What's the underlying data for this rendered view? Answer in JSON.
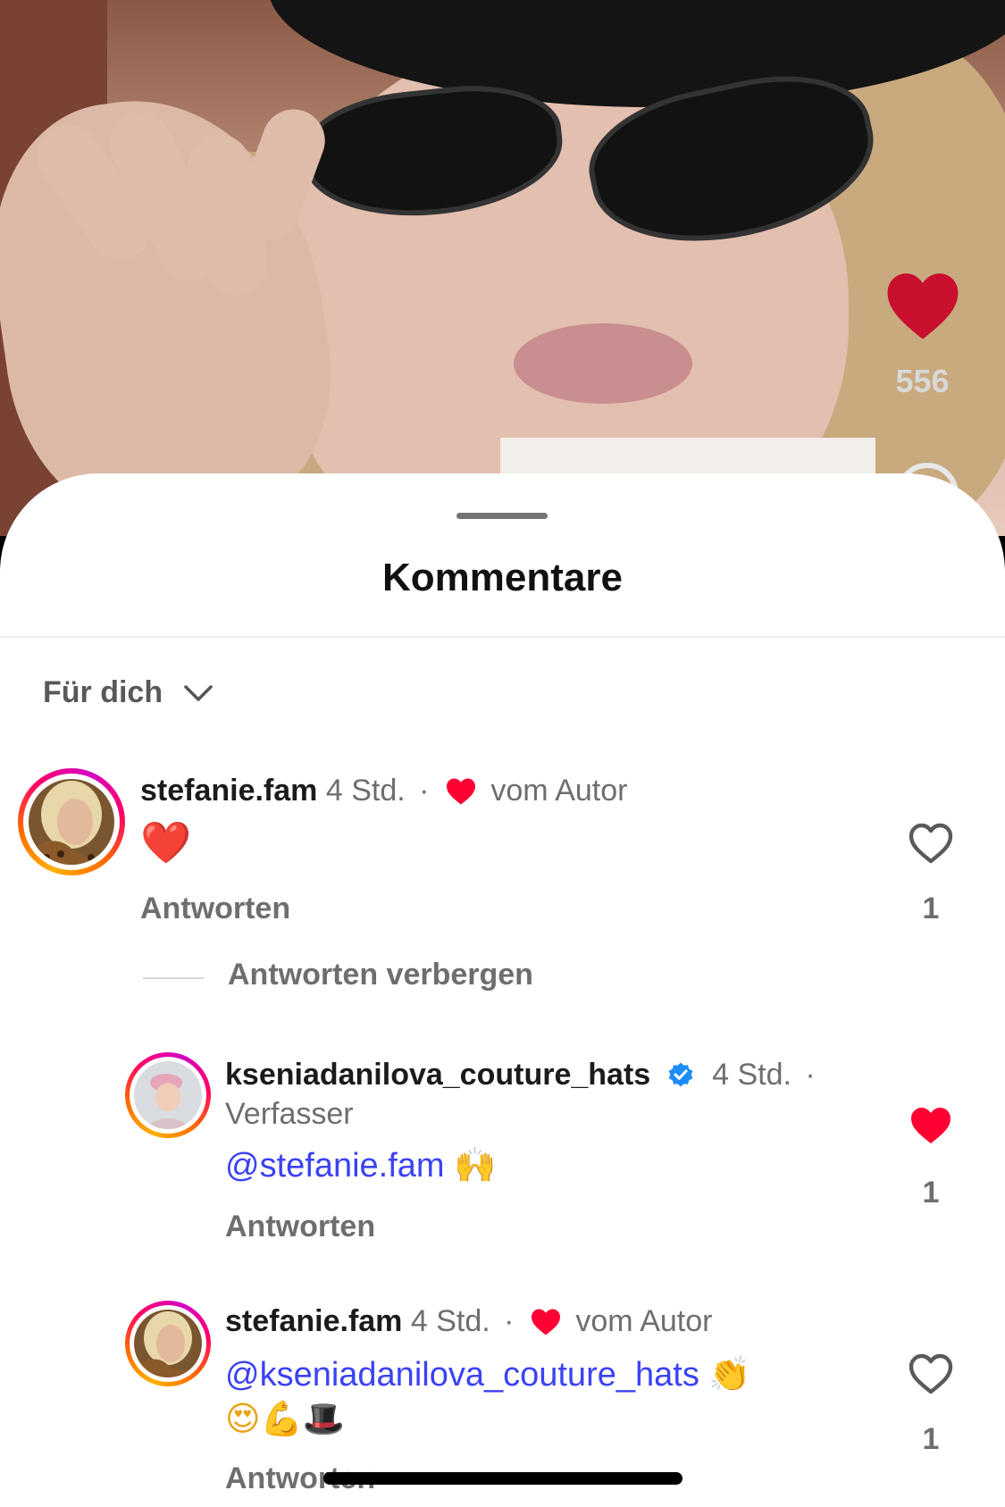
{
  "video": {
    "like_count": "556"
  },
  "sheet": {
    "title": "Kommentare",
    "filter_label": "Für dich"
  },
  "comments": [
    {
      "username": "stefanie.fam",
      "time": "4 Std.",
      "separator": "·",
      "author_badge": "vom Autor",
      "text": "❤️",
      "reply_label": "Antworten",
      "like_count": "1",
      "liked": false
    },
    {
      "username": "kseniadanilova_couture_hats",
      "verified": true,
      "time": "4 Std.",
      "separator": "·",
      "role": "Verfasser",
      "mention": "@stefanie.fam",
      "text": "🙌",
      "reply_label": "Antworten",
      "like_count": "1",
      "liked": true
    },
    {
      "username": "stefanie.fam",
      "time": "4 Std.",
      "separator": "·",
      "author_badge": "vom Autor",
      "mention": "@kseniadanilova_couture_hats",
      "text_line1": "👏",
      "text_line2": "😍💪🎩",
      "reply_label": "Antworten",
      "like_count": "1",
      "liked": false
    }
  ],
  "hide_replies_label": "Antworten verbergen",
  "colors": {
    "like_red": "#ff0033",
    "video_heart": "#c8102e",
    "mention_blue": "#3b42f5",
    "verified_blue": "#1d8cf8"
  }
}
